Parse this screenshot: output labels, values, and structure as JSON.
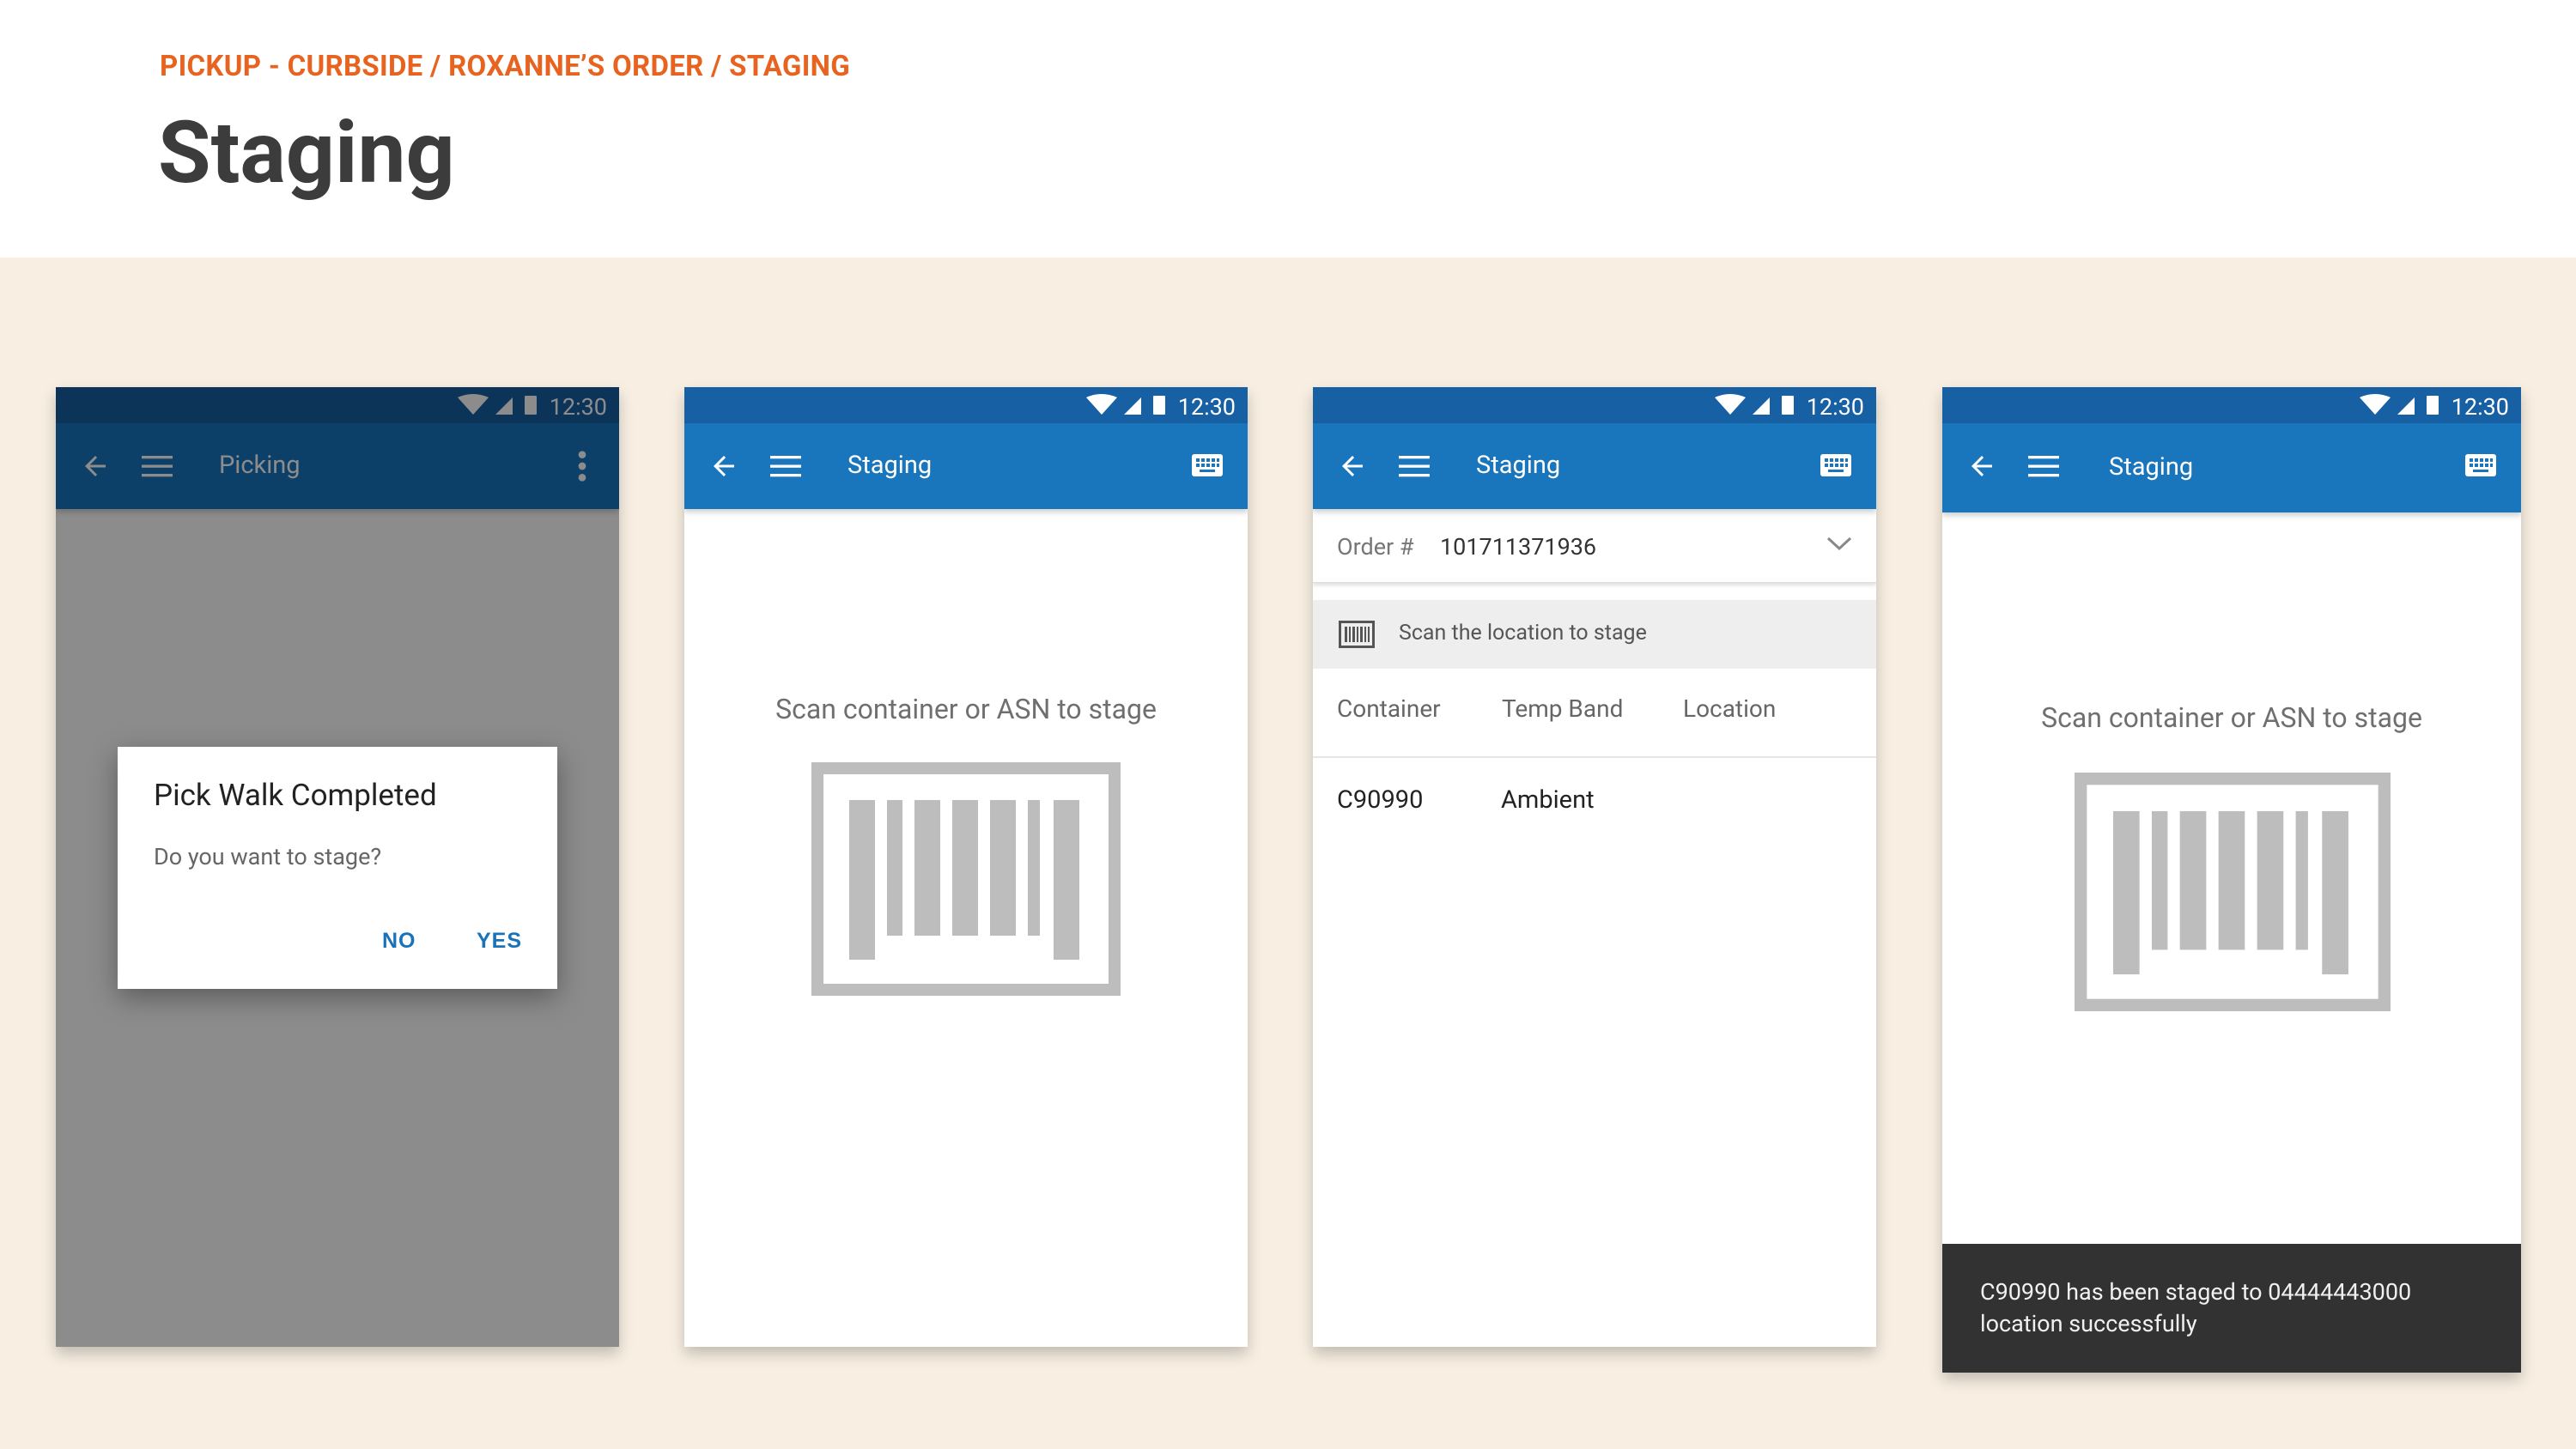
{
  "breadcrumb": "PICKUP - CURBSIDE / ROXANNE’S ORDER / STAGING",
  "page_title": "Staging",
  "status_time": "12:30",
  "screen1": {
    "title": "Picking",
    "dialog": {
      "title": "Pick Walk Completed",
      "message": "Do you want to stage?",
      "no_label": "NO",
      "yes_label": "YES"
    }
  },
  "screen2": {
    "title": "Staging",
    "prompt": "Scan container or ASN to stage"
  },
  "screen3": {
    "title": "Staging",
    "order_label": "Order #",
    "order_number": "101711371936",
    "scan_hint": "Scan the location to stage",
    "columns": [
      "Container",
      "Temp Band",
      "Location"
    ],
    "rows": [
      {
        "container": "C90990",
        "temp_band": "Ambient",
        "location": ""
      }
    ]
  },
  "screen4": {
    "title": "Staging",
    "prompt": "Scan container or ASN to stage",
    "snackbar": "C90990 has been staged to 04444443000 location successfully"
  },
  "colors": {
    "accent": "#E8631F",
    "status_bar": "#1760A3",
    "app_bar": "#1976BD",
    "canvas": "#F8EFE2",
    "snackbar": "#323232"
  }
}
